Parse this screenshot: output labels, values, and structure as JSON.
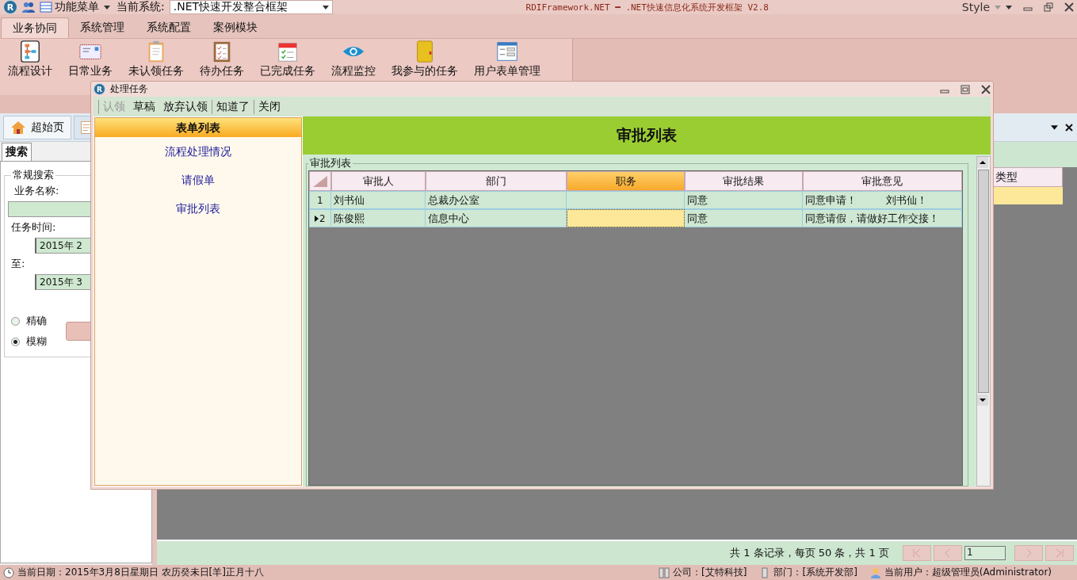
{
  "titlebar": {
    "logo": "R",
    "menu_label": "功能菜单",
    "system_label": "当前系统:",
    "system_value": ".NET快速开发整合框架",
    "app_title": "RDIFramework.NET ━ .NET快速信息化系统开发框架 V2.8",
    "style_label": "Style"
  },
  "ribbon_tabs": [
    {
      "label": "业务协同",
      "selected": true
    },
    {
      "label": "系统管理",
      "selected": false
    },
    {
      "label": "系统配置",
      "selected": false
    },
    {
      "label": "案例模块",
      "selected": false
    }
  ],
  "ribbon_buttons": [
    {
      "label": "流程设计"
    },
    {
      "label": "日常业务"
    },
    {
      "label": "未认领任务"
    },
    {
      "label": "待办任务"
    },
    {
      "label": "已完成任务"
    },
    {
      "label": "流程监控"
    },
    {
      "label": "我参与的任务"
    },
    {
      "label": "用户表单管理"
    }
  ],
  "doc_tabs": [
    {
      "label": "超始页",
      "selected": true
    },
    {
      "selected": false
    }
  ],
  "search_panel": {
    "tab": "搜索",
    "group": "常规搜索",
    "name_label": "业务名称:",
    "time_label": "任务时间:",
    "from_date": "2015年 2",
    "to_label": "至:",
    "to_date": "2015年 3",
    "options": [
      {
        "label": "精确",
        "selected": false
      },
      {
        "label": "模糊",
        "selected": true
      }
    ]
  },
  "main_grid": {
    "columns": [
      "类型"
    ]
  },
  "pager": {
    "summary": "共 1 条记录，每页 50 条，共 1 页",
    "page": "1"
  },
  "status_bar": {
    "date": "当前日期：2015年3月8日星期日 农历癸未日[羊]正月十八",
    "company": "公司：[艾特科技]",
    "department": "部门：[系统开发部]",
    "user": "当前用户：超级管理员(Administrator)"
  },
  "dialog": {
    "logo": "R",
    "title": "处理任务",
    "toolbar": [
      {
        "label": "认领",
        "disabled": true
      },
      {
        "label": "草稿",
        "disabled": false
      },
      {
        "label": "放弃认领",
        "disabled": false
      },
      {
        "label": "知道了",
        "disabled": false
      },
      {
        "label": "关闭",
        "disabled": false
      }
    ],
    "form_list": {
      "title": "表单列表",
      "items": [
        "流程处理情况",
        "请假单",
        "审批列表"
      ]
    },
    "header": "审批列表",
    "group_title": "审批列表",
    "grid": {
      "columns": [
        {
          "label": "审批人",
          "selected": false
        },
        {
          "label": "部门",
          "selected": false
        },
        {
          "label": "职务",
          "selected": true
        },
        {
          "label": "审批结果",
          "selected": false
        },
        {
          "label": "审批意见",
          "selected": false
        }
      ],
      "rows": [
        {
          "number": "1",
          "current": false,
          "cells": [
            "刘书仙",
            "总裁办公室",
            null,
            "同意",
            "同意申请！         刘书仙！"
          ]
        },
        {
          "number": "2",
          "current": true,
          "cells": [
            "陈俊熙",
            "信息中心",
            null,
            "同意",
            "同意请假，请做好工作交接！"
          ]
        }
      ]
    }
  }
}
